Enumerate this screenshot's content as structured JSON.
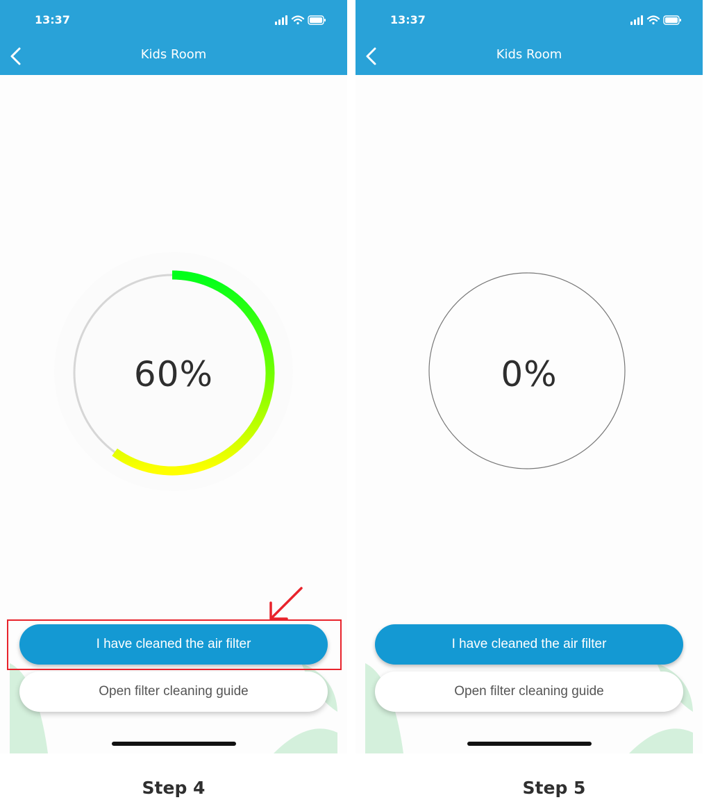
{
  "colors": {
    "header": "#29a2d8",
    "primary_button": "#1499d3",
    "gauge_start": "#00ff1a",
    "gauge_end": "#ffff00",
    "gauge_track": "#d6d6d6",
    "highlight": "#e8232b",
    "leaf": "#d4f0dc"
  },
  "screens": [
    {
      "status_time": "13:37",
      "title": "Kids Room",
      "gauge": {
        "value_text": "60%",
        "progress_fraction": 0.6
      },
      "primary_button": "I have cleaned the air filter",
      "secondary_button": "Open filter cleaning guide",
      "icons": [
        "signal-icon",
        "wifi-icon",
        "battery-icon",
        "back-arrow-icon"
      ]
    },
    {
      "status_time": "13:37",
      "title": "Kids Room",
      "gauge": {
        "value_text": "0%",
        "progress_fraction": 0
      },
      "primary_button": "I have cleaned the air filter",
      "secondary_button": "Open filter cleaning guide",
      "icons": [
        "signal-icon",
        "wifi-icon",
        "battery-icon",
        "back-arrow-icon"
      ]
    }
  ],
  "steps": [
    "Step 4",
    "Step 5"
  ],
  "annotation": {
    "icon": "red-arrow-icon",
    "target": "primary_button"
  }
}
